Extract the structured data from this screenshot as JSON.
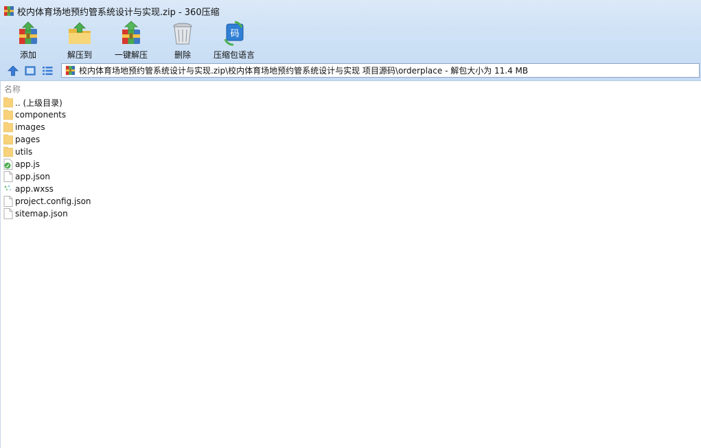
{
  "window": {
    "title": "校内体育场地预约管系统设计与实现.zip - 360压缩"
  },
  "toolbar": {
    "buttons": [
      {
        "id": "add",
        "label": "添加",
        "icon": "add-archive-icon"
      },
      {
        "id": "extract-to",
        "label": "解压到",
        "icon": "extract-folder-icon"
      },
      {
        "id": "one-click",
        "label": "一键解压",
        "icon": "one-click-extract-icon"
      },
      {
        "id": "delete",
        "label": "删除",
        "icon": "trash-can-icon"
      },
      {
        "id": "lang",
        "label": "压缩包语言",
        "icon": "archive-language-icon"
      }
    ]
  },
  "nav": {
    "path": "校内体育场地预约管系统设计与实现.zip\\校内体育场地预约管系统设计与实现 项目源码\\orderplace - 解包大小为 11.4 MB"
  },
  "filelist": {
    "column_name": "名称",
    "items": [
      {
        "name": ".. (上级目录)",
        "type": "folder"
      },
      {
        "name": "components",
        "type": "folder"
      },
      {
        "name": "images",
        "type": "folder"
      },
      {
        "name": "pages",
        "type": "folder"
      },
      {
        "name": "utils",
        "type": "folder"
      },
      {
        "name": "app.js",
        "type": "js"
      },
      {
        "name": "app.json",
        "type": "file"
      },
      {
        "name": "app.wxss",
        "type": "wxss"
      },
      {
        "name": "project.config.json",
        "type": "file"
      },
      {
        "name": "sitemap.json",
        "type": "file"
      }
    ]
  },
  "colors": {
    "chrome_top": "#dbe9f8",
    "chrome_bottom": "#c5dbf3",
    "accent": "#3a7bd5",
    "folder": "#f7d27a"
  }
}
